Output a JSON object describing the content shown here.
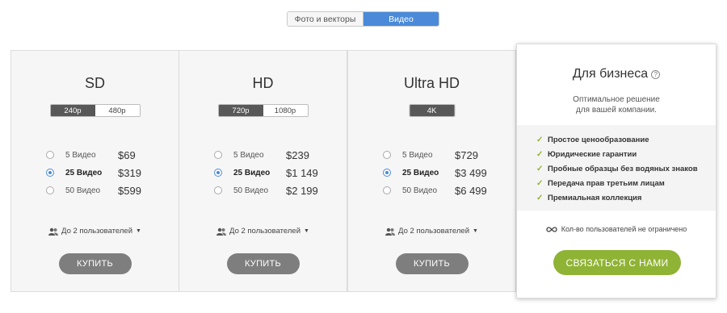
{
  "tabs": {
    "photo": "Фото и векторы",
    "video": "Видео",
    "active": "video"
  },
  "plans": [
    {
      "title": "SD",
      "resolutions": [
        "240p",
        "480p"
      ],
      "selected_resolution": "240p",
      "options": [
        {
          "label": "5 Видео",
          "price": "$69",
          "selected": false
        },
        {
          "label": "25 Видео",
          "price": "$319",
          "selected": true
        },
        {
          "label": "50 Видео",
          "price": "$599",
          "selected": false
        }
      ],
      "users": "До 2 пользователей",
      "buy": "КУПИТЬ"
    },
    {
      "title": "HD",
      "resolutions": [
        "720p",
        "1080p"
      ],
      "selected_resolution": "720p",
      "options": [
        {
          "label": "5 Видео",
          "price": "$239",
          "selected": false
        },
        {
          "label": "25 Видео",
          "price": "$1 149",
          "selected": true
        },
        {
          "label": "50 Видео",
          "price": "$2 199",
          "selected": false
        }
      ],
      "users": "До 2 пользователей",
      "buy": "КУПИТЬ"
    },
    {
      "title": "Ultra HD",
      "resolutions": [
        "4K"
      ],
      "selected_resolution": "4K",
      "options": [
        {
          "label": "5 Видео",
          "price": "$729",
          "selected": false
        },
        {
          "label": "25 Видео",
          "price": "$3 499",
          "selected": true
        },
        {
          "label": "50 Видео",
          "price": "$6 499",
          "selected": false
        }
      ],
      "users": "До 2 пользователей",
      "buy": "КУПИТЬ"
    }
  ],
  "business": {
    "title": "Для бизнеса",
    "help_icon": "?",
    "subtitle_line1": "Оптимальное решение",
    "subtitle_line2": "для вашей компании.",
    "features": [
      "Простое ценообразование",
      "Юридические гарантии",
      "Пробные образцы без водяных знаков",
      "Передача прав третьим лицам",
      "Премиальная коллекция"
    ],
    "unlimited": "Кол-во пользователей не ограничено",
    "contact": "СВЯЗАТЬСЯ С НАМИ"
  },
  "colors": {
    "accent_blue": "#4a8ad8",
    "green": "#8fb334",
    "buy_gray": "#7e7e7e",
    "dark_tab": "#585858"
  },
  "icons": {
    "users": "users-icon",
    "caret": "caret-down-icon",
    "check": "check-icon",
    "infinity": "infinity-icon",
    "help": "question-icon"
  }
}
